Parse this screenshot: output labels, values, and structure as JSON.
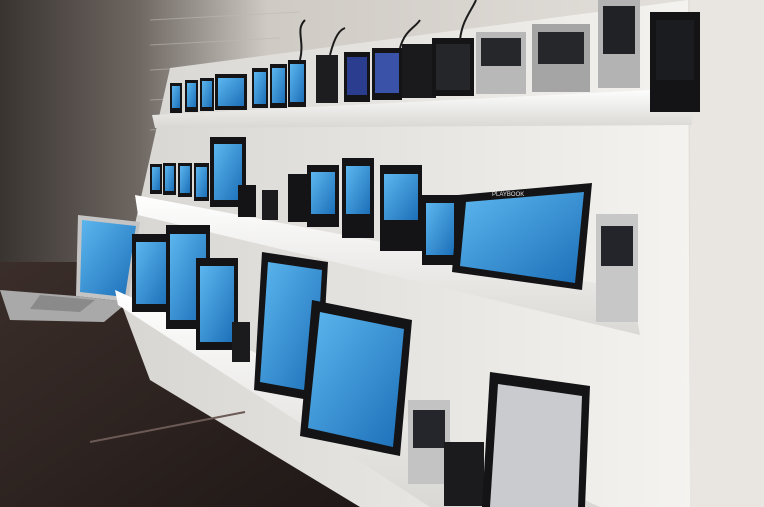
{
  "scene": {
    "description_free": true,
    "palette": {
      "wall": "#d9d6d1",
      "brick": "#b9b4ae",
      "dark_wall": "#3b3532",
      "board": "#f2f1ee",
      "shelf": "#f7f7f5",
      "desk": "#2f2522",
      "screen_blue": "#2e8fd6",
      "device_black": "#141416",
      "silver": "#c9c9c9"
    },
    "devices": {
      "top_shelf_count": 22,
      "middle_shelf_count": 20,
      "bottom_shelf_count": 13
    },
    "laptop": {
      "present": true
    },
    "tablet_label": "PLAYBOOK"
  }
}
